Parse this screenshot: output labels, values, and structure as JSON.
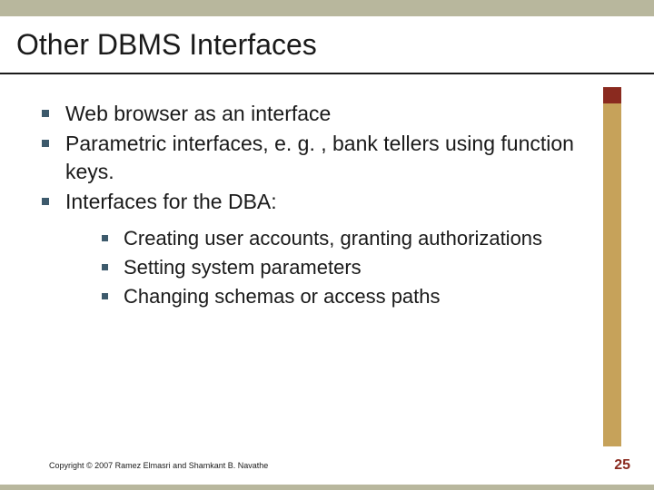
{
  "title": "Other DBMS Interfaces",
  "bullets": [
    {
      "text": "Web browser as an interface"
    },
    {
      "text": "Parametric interfaces, e. g. , bank tellers using function keys."
    },
    {
      "text": "Interfaces for the DBA:",
      "sub": [
        {
          "text": "Creating user accounts, granting authorizations"
        },
        {
          "text": "Setting system parameters"
        },
        {
          "text": "Changing schemas or access paths"
        }
      ]
    }
  ],
  "footer": {
    "copyright": "Copyright © 2007 Ramez Elmasri and Shamkant B. Navathe",
    "page": "25"
  }
}
